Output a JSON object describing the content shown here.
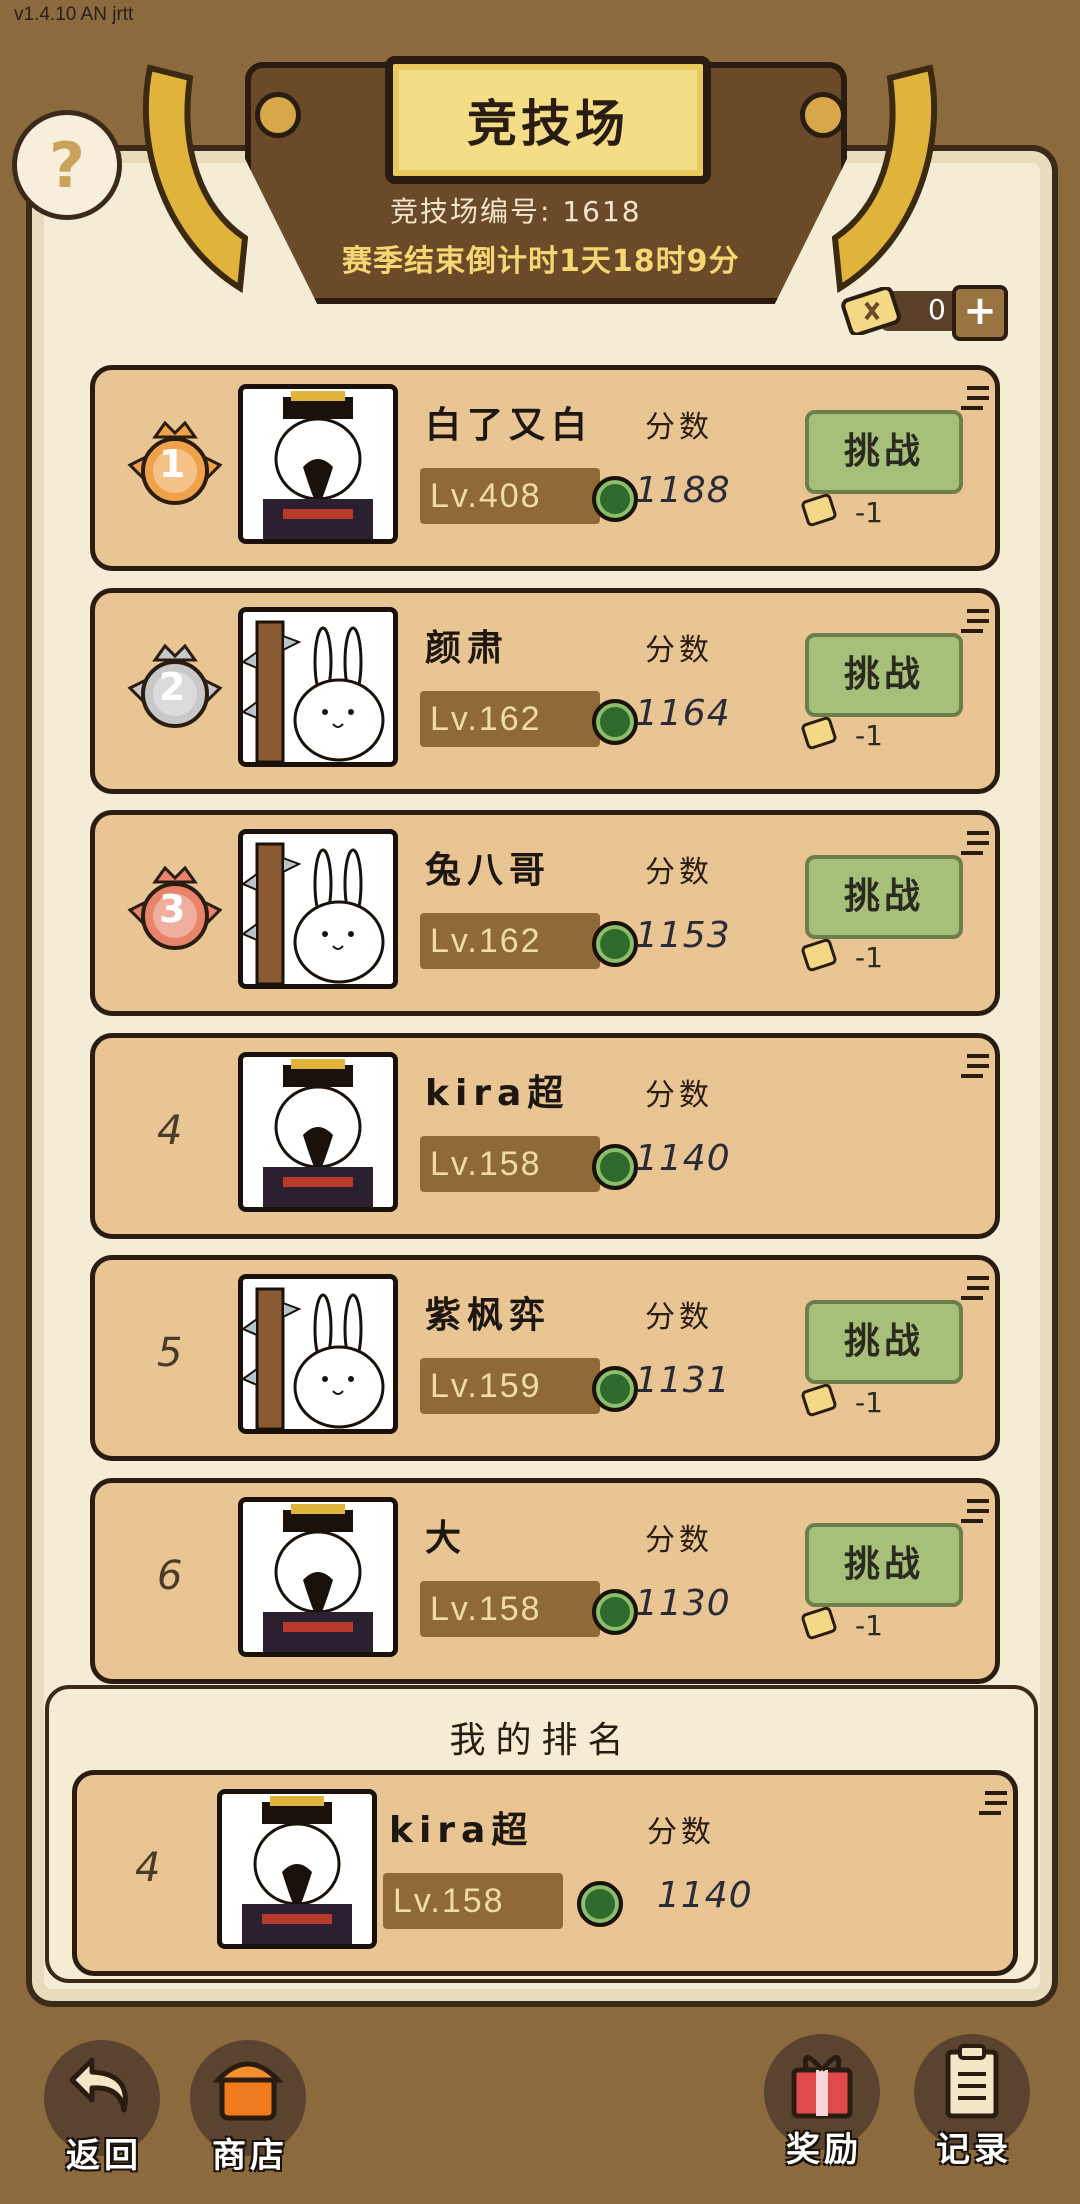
{
  "version": "v1.4.10 AN jrtt",
  "header": {
    "title": "竞技场",
    "arena_id_text": "竞技场编号:  1618",
    "countdown_text": "赛季结束倒计时1天18时9分"
  },
  "help_label": "?",
  "tickets": {
    "count": "0",
    "plus": "+"
  },
  "score_label": "分数",
  "challenge_label": "挑战",
  "challenge_cost": "-1",
  "players": [
    {
      "rank": "1",
      "medal": "gold",
      "name": "白了又白",
      "level": "Lv.408",
      "score": "1188",
      "avatar": "emperor",
      "can_challenge": true
    },
    {
      "rank": "2",
      "medal": "silver",
      "name": "颜肃",
      "level": "Lv.162",
      "score": "1164",
      "avatar": "rabbit",
      "can_challenge": true
    },
    {
      "rank": "3",
      "medal": "bronze",
      "name": "兔八哥",
      "level": "Lv.162",
      "score": "1153",
      "avatar": "rabbit",
      "can_challenge": true
    },
    {
      "rank": "4",
      "medal": "",
      "name": "kira超",
      "level": "Lv.158",
      "score": "1140",
      "avatar": "emperor",
      "can_challenge": false
    },
    {
      "rank": "5",
      "medal": "",
      "name": "紫枫弈",
      "level": "Lv.159",
      "score": "1131",
      "avatar": "rabbit",
      "can_challenge": true
    },
    {
      "rank": "6",
      "medal": "",
      "name": "大",
      "level": "Lv.158",
      "score": "1130",
      "avatar": "emperor",
      "can_challenge": true
    }
  ],
  "my_rank": {
    "title": "我的排名",
    "rank": "4",
    "name": "kira超",
    "level": "Lv.158",
    "score": "1140"
  },
  "bottom_nav": {
    "back": "返回",
    "shop": "商店",
    "rewards": "奖励",
    "records": "记录"
  },
  "colors": {
    "gold": "#f0a24a",
    "silver": "#c8c8c8",
    "bronze": "#e8846a",
    "challenge_green": "#a6c07a"
  }
}
